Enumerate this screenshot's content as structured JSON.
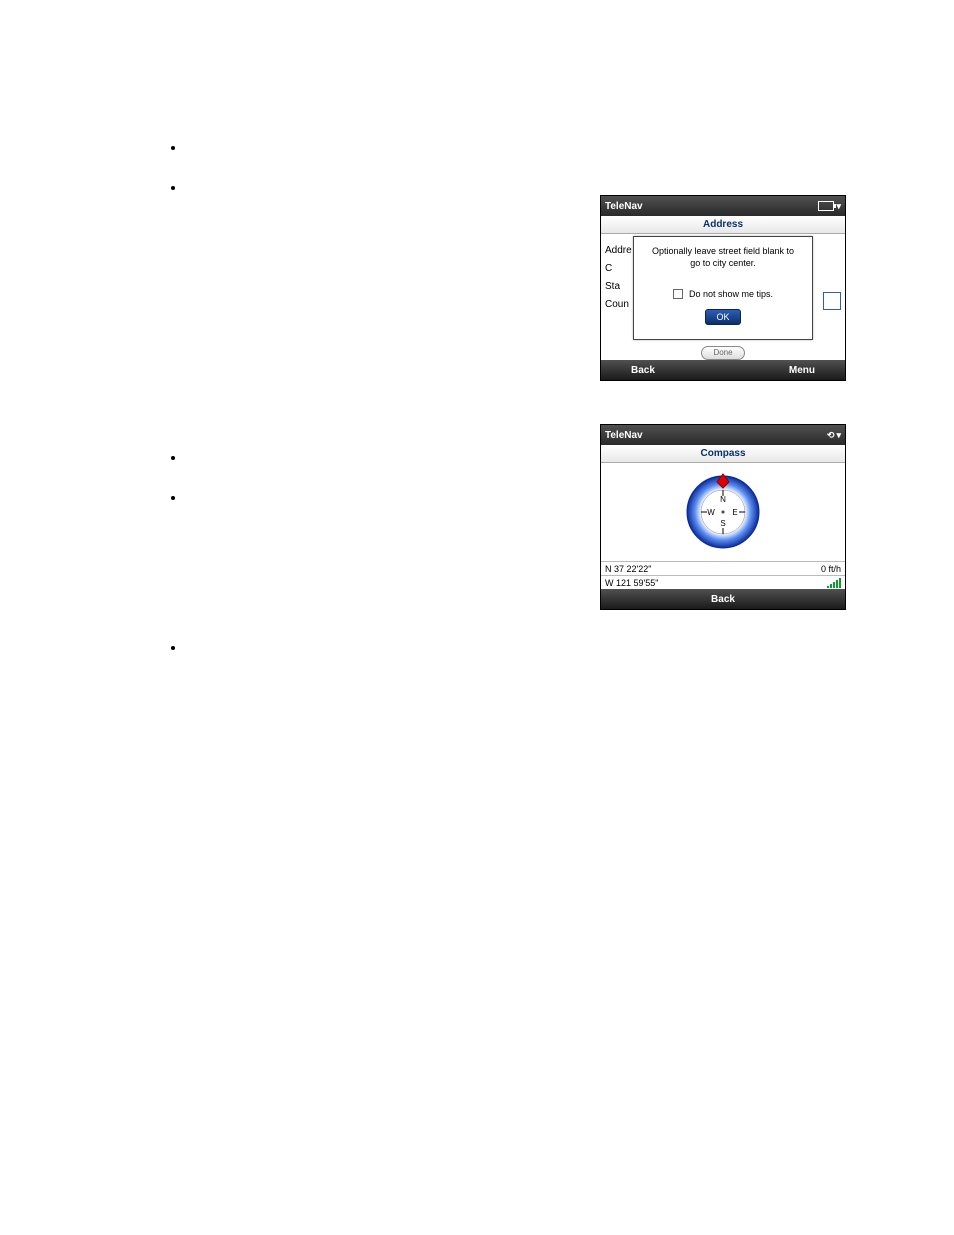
{
  "bullets": {
    "b1": "",
    "b2": "",
    "b3": "",
    "b4": "",
    "b5": ""
  },
  "fig1": {
    "title": "TeleNav",
    "page_header": "Address",
    "labels": {
      "l1": "Addre",
      "l2": "C",
      "l3": "Sta",
      "l4": "Coun"
    },
    "done_label": "Done",
    "dialog": {
      "message": "Optionally leave street field blank to go to city center.",
      "checkbox_label": "Do not show me tips.",
      "ok_label": "OK"
    },
    "softkeys": {
      "left": "Back",
      "right": "Menu"
    }
  },
  "fig2": {
    "title": "TeleNav",
    "page_header": "Compass",
    "compass": {
      "n": "N",
      "s": "S",
      "e": "E",
      "w": "W"
    },
    "status": {
      "lat": "N 37 22'22\"",
      "lon": "W 121 59'55\"",
      "speed": "0 ft/h"
    },
    "softkeys": {
      "left": "Back"
    }
  }
}
